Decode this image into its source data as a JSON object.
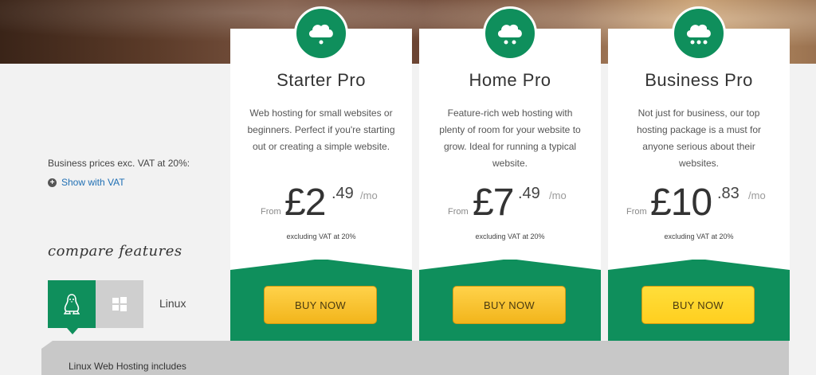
{
  "pricing_note": {
    "vat_text": "Business prices exc. VAT at 20%:",
    "show_vat_link": "Show with VAT"
  },
  "compare": {
    "title": "compare features",
    "selected_os": "Linux",
    "os_options": [
      "Linux",
      "Windows"
    ],
    "includes_text": "Linux Web Hosting includes"
  },
  "plans": [
    {
      "name": "Starter Pro",
      "description": "Web hosting for small websites or beginners. Perfect if you're starting out or creating a simple website.",
      "from_label": "From",
      "price_pounds": "£2",
      "price_pence": ".49",
      "period": "/mo",
      "vat_note": "excluding VAT at 20%",
      "button": "BUY NOW",
      "icon": "cloud-one-dot-icon"
    },
    {
      "name": "Home Pro",
      "description": "Feature-rich web hosting with plenty of room for your website to grow. Ideal for running a typical website.",
      "from_label": "From",
      "price_pounds": "£7",
      "price_pence": ".49",
      "period": "/mo",
      "vat_note": "excluding VAT at 20%",
      "button": "BUY NOW",
      "icon": "cloud-two-dots-icon"
    },
    {
      "name": "Business Pro",
      "description": "Not just for business, our top hosting package is a must for anyone serious about their websites.",
      "from_label": "From",
      "price_pounds": "£10",
      "price_pence": ".83",
      "period": "/mo",
      "vat_note": "excluding VAT at 20%",
      "button": "BUY NOW",
      "icon": "cloud-three-dots-icon"
    }
  ],
  "colors": {
    "brand_green": "#0f8f5c",
    "button_yellow": "#f2b51b",
    "link_blue": "#1f6fb4"
  }
}
